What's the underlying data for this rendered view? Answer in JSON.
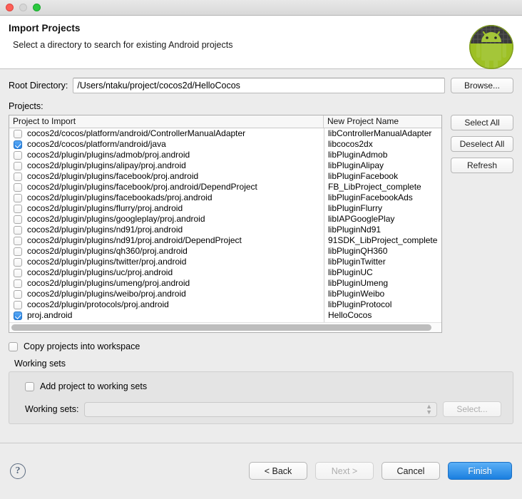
{
  "window": {
    "traffic_lights": [
      "close",
      "minimize",
      "maximize"
    ]
  },
  "header": {
    "title": "Import Projects",
    "subtitle": "Select a directory to search for existing Android projects",
    "logo_icon": "android-robot-icon"
  },
  "root_directory": {
    "label": "Root Directory:",
    "value": "/Users/ntaku/project/cocos2d/HelloCocos",
    "placeholder": "",
    "browse_label": "Browse..."
  },
  "projects": {
    "label": "Projects:",
    "columns": [
      "Project to Import",
      "New Project Name"
    ],
    "rows": [
      {
        "checked": false,
        "path": "cocos2d/cocos/platform/android/ControllerManualAdapter",
        "name": "libControllerManualAdapter"
      },
      {
        "checked": true,
        "path": "cocos2d/cocos/platform/android/java",
        "name": "libcocos2dx"
      },
      {
        "checked": false,
        "path": "cocos2d/plugin/plugins/admob/proj.android",
        "name": "libPluginAdmob"
      },
      {
        "checked": false,
        "path": "cocos2d/plugin/plugins/alipay/proj.android",
        "name": "libPluginAlipay"
      },
      {
        "checked": false,
        "path": "cocos2d/plugin/plugins/facebook/proj.android",
        "name": "libPluginFacebook"
      },
      {
        "checked": false,
        "path": "cocos2d/plugin/plugins/facebook/proj.android/DependProject",
        "name": "FB_LibProject_complete"
      },
      {
        "checked": false,
        "path": "cocos2d/plugin/plugins/facebookads/proj.android",
        "name": "libPluginFacebookAds"
      },
      {
        "checked": false,
        "path": "cocos2d/plugin/plugins/flurry/proj.android",
        "name": "libPluginFlurry"
      },
      {
        "checked": false,
        "path": "cocos2d/plugin/plugins/googleplay/proj.android",
        "name": "libIAPGooglePlay"
      },
      {
        "checked": false,
        "path": "cocos2d/plugin/plugins/nd91/proj.android",
        "name": "libPluginNd91"
      },
      {
        "checked": false,
        "path": "cocos2d/plugin/plugins/nd91/proj.android/DependProject",
        "name": "91SDK_LibProject_complete"
      },
      {
        "checked": false,
        "path": "cocos2d/plugin/plugins/qh360/proj.android",
        "name": "libPluginQH360"
      },
      {
        "checked": false,
        "path": "cocos2d/plugin/plugins/twitter/proj.android",
        "name": "libPluginTwitter"
      },
      {
        "checked": false,
        "path": "cocos2d/plugin/plugins/uc/proj.android",
        "name": "libPluginUC"
      },
      {
        "checked": false,
        "path": "cocos2d/plugin/plugins/umeng/proj.android",
        "name": "libPluginUmeng"
      },
      {
        "checked": false,
        "path": "cocos2d/plugin/plugins/weibo/proj.android",
        "name": "libPluginWeibo"
      },
      {
        "checked": false,
        "path": "cocos2d/plugin/protocols/proj.android",
        "name": "libPluginProtocol"
      },
      {
        "checked": true,
        "path": "proj.android",
        "name": "HelloCocos"
      }
    ],
    "side_buttons": [
      {
        "label": "Select All",
        "enabled": true
      },
      {
        "label": "Deselect All",
        "enabled": true
      },
      {
        "label": "Refresh",
        "enabled": true
      }
    ]
  },
  "copy_projects": {
    "label": "Copy projects into workspace",
    "checked": false
  },
  "working_sets": {
    "group_title": "Working sets",
    "add_label": "Add project to working sets",
    "add_checked": false,
    "combo_label": "Working sets:",
    "combo_value": "",
    "combo_enabled": false,
    "select_label": "Select...",
    "select_enabled": false
  },
  "footer": {
    "help_icon": "help-question-icon",
    "back_label": "< Back",
    "next_label": "Next >",
    "next_enabled": false,
    "cancel_label": "Cancel",
    "finish_label": "Finish"
  },
  "colors": {
    "accent": "#2a86e8",
    "finish_button": "#1a7fe0",
    "android_green": "#a4c639",
    "window_bg": "#ececec"
  }
}
